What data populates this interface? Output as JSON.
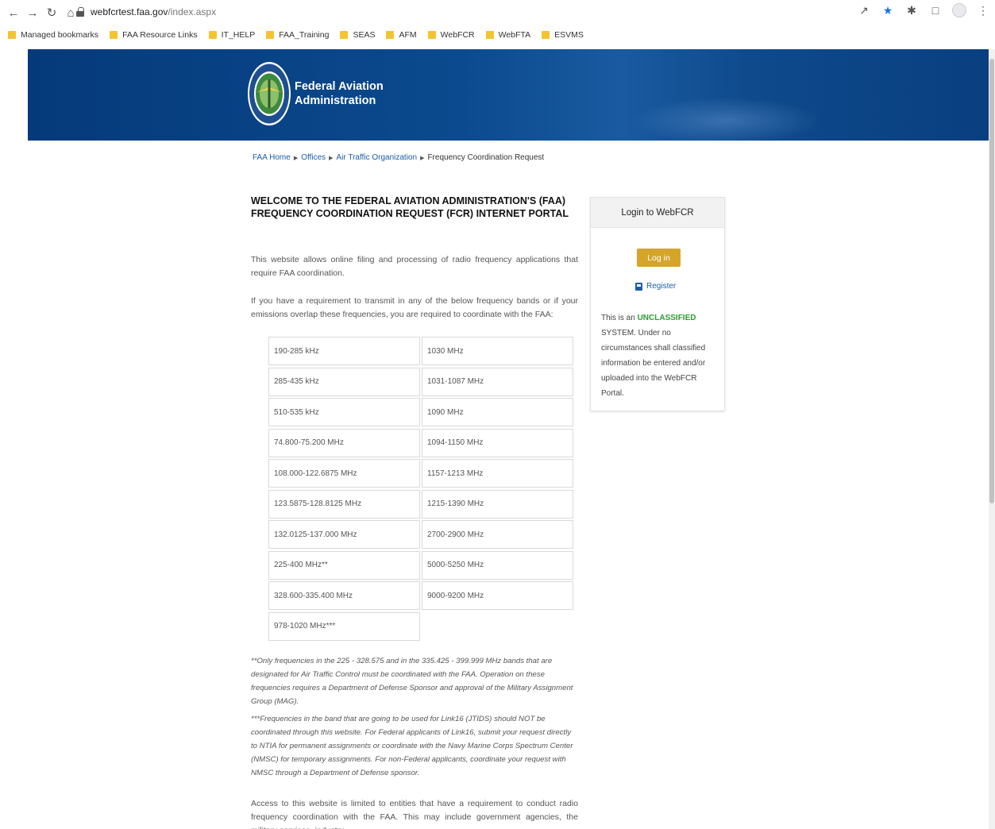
{
  "browser": {
    "url_host": "webfcrtest.faa.gov",
    "url_path": "/index.aspx",
    "bookmarks": [
      "Managed bookmarks",
      "FAA Resource Links",
      "IT_HELP",
      "FAA_Training",
      "SEAS",
      "AFM",
      "WebFCR",
      "WebFTA",
      "ESVMS"
    ]
  },
  "header": {
    "title_line1": "Federal Aviation",
    "title_line2": "Administration"
  },
  "breadcrumb": [
    "FAA Home",
    "Offices",
    "Air Traffic Organization",
    "Frequency Coordination Request"
  ],
  "main": {
    "heading_line1": "WELCOME TO THE FEDERAL AVIATION ADMINISTRATION'S (FAA)",
    "heading_line2": "FREQUENCY COORDINATION REQUEST (FCR) INTERNET PORTAL",
    "intro": "This website allows online filing and processing of radio frequency applications that require FAA coordination.",
    "requirement": "If you have a requirement to transmit in any of the below frequency bands or if your emissions overlap these frequencies, you are required to coordinate with the FAA:",
    "bands_left": [
      "190-285 kHz",
      "285-435 kHz",
      "510-535 kHz",
      "74.800-75.200 MHz",
      "108.000-122.6875 MHz",
      "123.5875-128.8125 MHz",
      "132.0125-137.000 MHz",
      "225-400 MHz**",
      "328.600-335.400 MHz",
      "978-1020 MHz***"
    ],
    "bands_right": [
      "1030 MHz",
      "1031-1087 MHz",
      "1090 MHz",
      "1094-1150 MHz",
      "1157-1213 MHz",
      "1215-1390 MHz",
      "2700-2900 MHz",
      "5000-5250 MHz",
      "9000-9200 MHz"
    ],
    "note1": "**Only frequencies in the 225 - 328.575 and in the 335.425 - 399.999 MHz bands that are designated for Air Traffic Control must be coordinated with the FAA. Operation on these frequencies requires a Department of Defense Sponsor and approval of the Military Assignment Group (MAG).",
    "note2": "***Frequencies in the band that are going to be used for Link16 (JTIDS) should NOT be coordinated through this website. For Federal applicants of Link16, submit your request directly to NTIA for permanent assignments or coordinate with the Navy Marine Corps Spectrum Center (NMSC) for temporary assignments. For non-Federal applicants, coordinate your request with NMSC through a Department of Defense sponsor.",
    "access": "Access to this website is limited to entities that have a requirement to conduct radio frequency coordination with the FAA. This may include government agencies, the military services, industry,"
  },
  "login": {
    "title": "Login to WebFCR",
    "login_label": "Log in",
    "register_label": "Register",
    "disclaimer_pre": "This is an ",
    "disclaimer_unclassified": "UNCLASSIFIED",
    "disclaimer_post": " SYSTEM. Under no circumstances shall classified information be entered and/or uploaded into the WebFCR Portal."
  },
  "colors": {
    "banner": "#0b4a8e",
    "login_button": "#d4a52a",
    "link": "#1a5ea8",
    "unclassified": "#2e9d34"
  }
}
